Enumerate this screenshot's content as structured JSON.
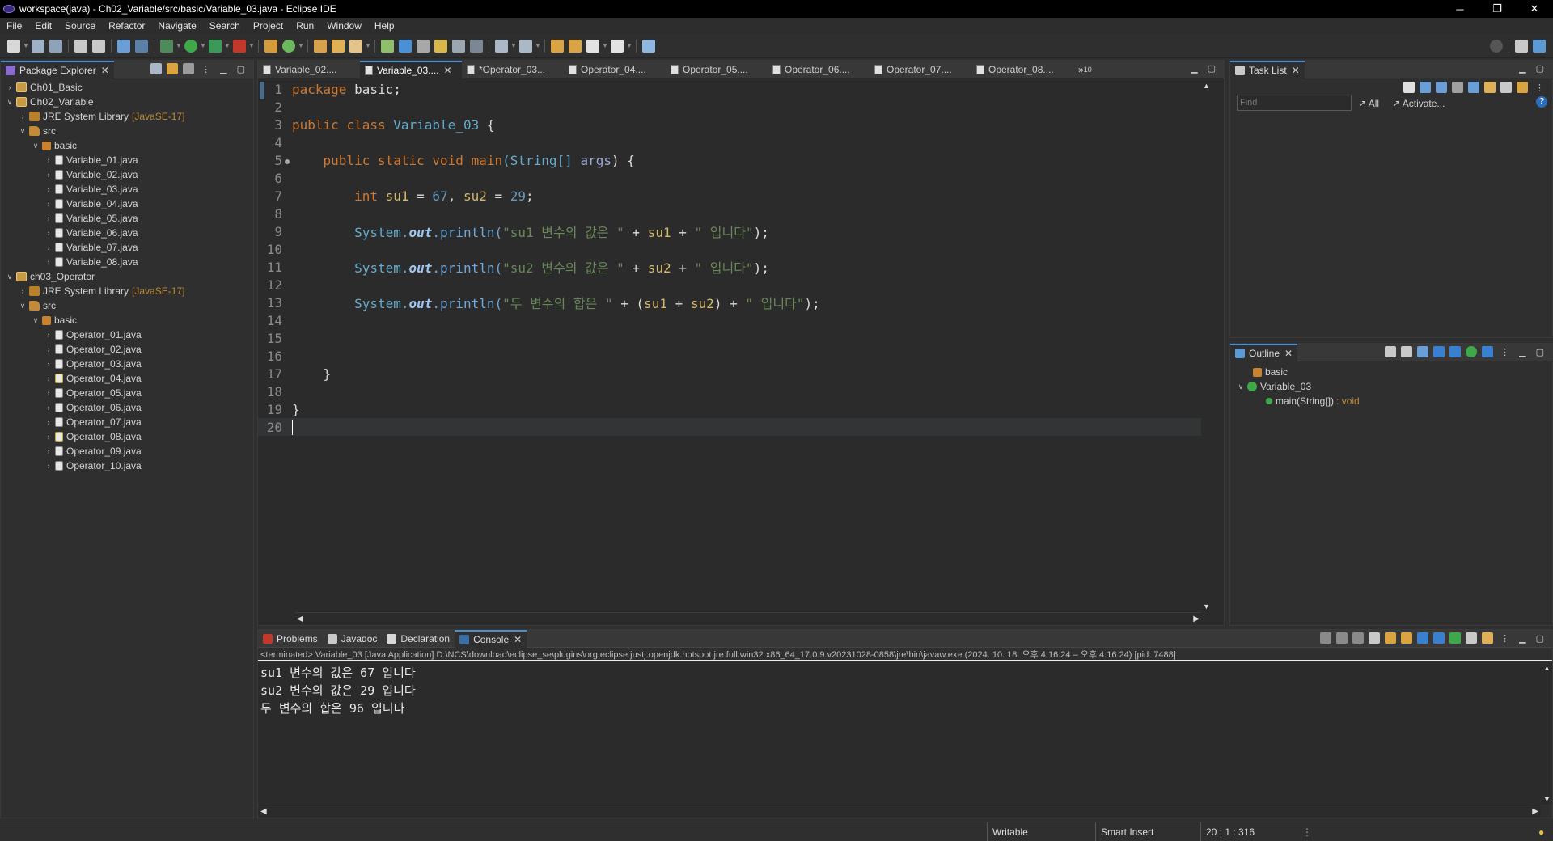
{
  "window": {
    "title": "workspace(java) - Ch02_Variable/src/basic/Variable_03.java - Eclipse IDE",
    "minimize": "─",
    "restore": "❐",
    "close": "✕"
  },
  "menu": [
    "File",
    "Edit",
    "Source",
    "Refactor",
    "Navigate",
    "Search",
    "Project",
    "Run",
    "Window",
    "Help"
  ],
  "package_explorer": {
    "tab_label": "Package Explorer",
    "tree": [
      {
        "label": "Ch01_Basic",
        "level": 0,
        "icon": "project",
        "expanded": false
      },
      {
        "label": "Ch02_Variable",
        "level": 0,
        "icon": "project",
        "expanded": true
      },
      {
        "label": "JRE System Library",
        "suffix": "[JavaSE-17]",
        "level": 1,
        "icon": "lib",
        "expanded": false
      },
      {
        "label": "src",
        "level": 1,
        "icon": "src",
        "expanded": true
      },
      {
        "label": "basic",
        "level": 2,
        "icon": "pkg",
        "expanded": true
      },
      {
        "label": "Variable_01.java",
        "level": 3,
        "icon": "java",
        "expanded": false
      },
      {
        "label": "Variable_02.java",
        "level": 3,
        "icon": "java",
        "expanded": false
      },
      {
        "label": "Variable_03.java",
        "level": 3,
        "icon": "java",
        "expanded": false
      },
      {
        "label": "Variable_04.java",
        "level": 3,
        "icon": "java",
        "expanded": false
      },
      {
        "label": "Variable_05.java",
        "level": 3,
        "icon": "java",
        "expanded": false
      },
      {
        "label": "Variable_06.java",
        "level": 3,
        "icon": "java",
        "expanded": false
      },
      {
        "label": "Variable_07.java",
        "level": 3,
        "icon": "java",
        "expanded": false
      },
      {
        "label": "Variable_08.java",
        "level": 3,
        "icon": "java",
        "expanded": false
      },
      {
        "label": "ch03_Operator",
        "level": 0,
        "icon": "project",
        "expanded": true
      },
      {
        "label": "JRE System Library",
        "suffix": "[JavaSE-17]",
        "level": 1,
        "icon": "lib",
        "expanded": false
      },
      {
        "label": "src",
        "level": 1,
        "icon": "src",
        "expanded": true
      },
      {
        "label": "basic",
        "level": 2,
        "icon": "pkg",
        "expanded": true
      },
      {
        "label": "Operator_01.java",
        "level": 3,
        "icon": "java",
        "expanded": false
      },
      {
        "label": "Operator_02.java",
        "level": 3,
        "icon": "java",
        "expanded": false
      },
      {
        "label": "Operator_03.java",
        "level": 3,
        "icon": "java",
        "expanded": false
      },
      {
        "label": "Operator_04.java",
        "level": 3,
        "icon": "java-warn",
        "expanded": false
      },
      {
        "label": "Operator_05.java",
        "level": 3,
        "icon": "java",
        "expanded": false
      },
      {
        "label": "Operator_06.java",
        "level": 3,
        "icon": "java",
        "expanded": false
      },
      {
        "label": "Operator_07.java",
        "level": 3,
        "icon": "java",
        "expanded": false
      },
      {
        "label": "Operator_08.java",
        "level": 3,
        "icon": "java-warn",
        "expanded": false
      },
      {
        "label": "Operator_09.java",
        "level": 3,
        "icon": "java",
        "expanded": false
      },
      {
        "label": "Operator_10.java",
        "level": 3,
        "icon": "java",
        "expanded": false
      }
    ]
  },
  "editor": {
    "tabs": [
      {
        "label": "Variable_02....",
        "active": false
      },
      {
        "label": "Variable_03....",
        "active": true
      },
      {
        "label": "*Operator_03...",
        "active": false
      },
      {
        "label": "Operator_04....",
        "active": false
      },
      {
        "label": "Operator_05....",
        "active": false
      },
      {
        "label": "Operator_06....",
        "active": false
      },
      {
        "label": "Operator_07....",
        "active": false
      },
      {
        "label": "Operator_08....",
        "active": false
      }
    ],
    "overflow_label": "»",
    "overflow_count": "10",
    "lines": [
      [
        [
          "kw",
          "package"
        ],
        [
          "plain",
          " basic;"
        ]
      ],
      [],
      [
        [
          "kw",
          "public"
        ],
        [
          "plain",
          " "
        ],
        [
          "kw",
          "class"
        ],
        [
          "plain",
          " "
        ],
        [
          "cls",
          "Variable_03"
        ],
        [
          "plain",
          " {"
        ]
      ],
      [],
      [
        [
          "plain",
          "    "
        ],
        [
          "kw",
          "public"
        ],
        [
          "plain",
          " "
        ],
        [
          "kw",
          "static"
        ],
        [
          "plain",
          " "
        ],
        [
          "kw",
          "void"
        ],
        [
          "plain",
          " "
        ],
        [
          "kw",
          "main"
        ],
        [
          "cls",
          "(String[]"
        ],
        [
          "plain",
          " "
        ],
        [
          "param",
          "args"
        ],
        [
          "plain",
          ") {"
        ]
      ],
      [],
      [
        [
          "plain",
          "        "
        ],
        [
          "kw",
          "int"
        ],
        [
          "plain",
          " "
        ],
        [
          "var",
          "su1"
        ],
        [
          "plain",
          " = "
        ],
        [
          "num",
          "67"
        ],
        [
          "plain",
          ", "
        ],
        [
          "var",
          "su2"
        ],
        [
          "plain",
          " = "
        ],
        [
          "num",
          "29"
        ],
        [
          "plain",
          ";"
        ]
      ],
      [],
      [
        [
          "plain",
          "        "
        ],
        [
          "cls",
          "System."
        ],
        [
          "field",
          "out"
        ],
        [
          "meth",
          ".println("
        ],
        [
          "str",
          "\"su1 변수의 값은 \""
        ],
        [
          "plain",
          " + "
        ],
        [
          "var",
          "su1"
        ],
        [
          "plain",
          " + "
        ],
        [
          "str",
          "\" 입니다\""
        ],
        [
          "plain",
          ");"
        ]
      ],
      [],
      [
        [
          "plain",
          "        "
        ],
        [
          "cls",
          "System."
        ],
        [
          "field",
          "out"
        ],
        [
          "meth",
          ".println("
        ],
        [
          "str",
          "\"su2 변수의 값은 \""
        ],
        [
          "plain",
          " + "
        ],
        [
          "var",
          "su2"
        ],
        [
          "plain",
          " + "
        ],
        [
          "str",
          "\" 입니다\""
        ],
        [
          "plain",
          ");"
        ]
      ],
      [],
      [
        [
          "plain",
          "        "
        ],
        [
          "cls",
          "System."
        ],
        [
          "field",
          "out"
        ],
        [
          "meth",
          ".println("
        ],
        [
          "str",
          "\"두 변수의 합은 \""
        ],
        [
          "plain",
          " + ("
        ],
        [
          "var",
          "su1"
        ],
        [
          "plain",
          " + "
        ],
        [
          "var",
          "su2"
        ],
        [
          "plain",
          ") + "
        ],
        [
          "str",
          "\" 입니다\""
        ],
        [
          "plain",
          ");"
        ]
      ],
      [],
      [],
      [],
      [
        [
          "plain",
          "    }"
        ]
      ],
      [],
      [
        [
          "plain",
          "}"
        ]
      ],
      []
    ],
    "current_line": 20,
    "fold_line": 5
  },
  "task_list": {
    "tab_label": "Task List",
    "find_placeholder": "Find",
    "all_label": "All",
    "activate_label": "Activate...",
    "help": "?"
  },
  "outline": {
    "tab_label": "Outline",
    "items": [
      {
        "label": "basic",
        "level": 0
      },
      {
        "label": "Variable_03",
        "level": 0
      },
      {
        "label": "main(String[])",
        "type": ": void",
        "level": 1
      }
    ]
  },
  "bottom_tabs": [
    {
      "label": "Problems",
      "active": false
    },
    {
      "label": "Javadoc",
      "active": false
    },
    {
      "label": "Declaration",
      "active": false
    },
    {
      "label": "Console",
      "active": true
    }
  ],
  "console": {
    "path": "<terminated> Variable_03 [Java Application] D:\\NCS\\download\\eclipse_se\\plugins\\org.eclipse.justj.openjdk.hotspot.jre.full.win32.x86_64_17.0.9.v20231028-0858\\jre\\bin\\javaw.exe  (2024. 10. 18. 오후 4:16:24 – 오후 4:16:24) [pid: 7488]",
    "output": [
      "su1 변수의 값은 67 입니다",
      "su2 변수의 값은 29 입니다",
      "두 변수의 합은 96 입니다"
    ]
  },
  "status": {
    "writable": "Writable",
    "insert_mode": "Smart Insert",
    "position": "20 : 1 : 316"
  },
  "colors": {
    "accent": "#4d8fce",
    "keyword": "#cc7832",
    "string": "#6a8759",
    "number": "#6897bb"
  }
}
